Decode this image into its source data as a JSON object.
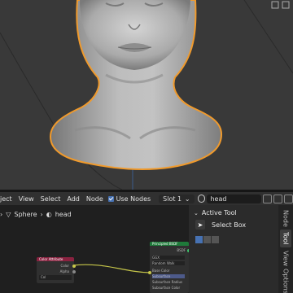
{
  "header": {
    "editor_suffix": "ject",
    "menu": [
      "View",
      "Select",
      "Add",
      "Node"
    ],
    "use_nodes_label": "Use Nodes",
    "slot_value": "Slot 1",
    "material_name": "head"
  },
  "breadcrumb": {
    "object": "Sphere",
    "material": "head"
  },
  "sidepanel": {
    "section_title": "Active Tool",
    "tool_name": "Select Box"
  },
  "tabs": [
    "Node",
    "Tool",
    "View",
    "Options"
  ],
  "nodes": {
    "color_attribute": {
      "title": "Color Attribute",
      "out_color": "Color",
      "out_alpha": "Alpha",
      "field": "Col"
    },
    "principled": {
      "title": "Principled BSDF",
      "output": "BSDF",
      "rows": [
        "GGX",
        "Random Walk",
        "Base Color",
        "Subsurface",
        "Subsurface Radius",
        "Subsurface Color"
      ]
    }
  },
  "colors": {
    "accent": "#4772b3",
    "outline": "#f09a2c",
    "node_green": "#1f7a3a",
    "node_red": "#8a2240"
  }
}
